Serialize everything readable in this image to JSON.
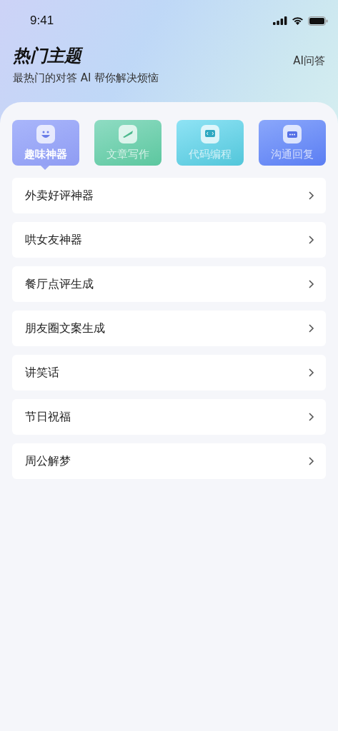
{
  "status_bar": {
    "time": "9:41"
  },
  "header": {
    "title": "热门主题",
    "subtitle": "最热门的对答 AI 帮你解决烦恼",
    "action": "AI问答"
  },
  "tabs": [
    {
      "label": "趣味神器",
      "selected": true,
      "kind": "fun"
    },
    {
      "label": "文章写作",
      "selected": false,
      "kind": "writing"
    },
    {
      "label": "代码编程",
      "selected": false,
      "kind": "code"
    },
    {
      "label": "沟通回复",
      "selected": false,
      "kind": "chat"
    }
  ],
  "items": [
    {
      "label": "外卖好评神器"
    },
    {
      "label": "哄女友神器"
    },
    {
      "label": "餐厅点评生成"
    },
    {
      "label": "朋友圈文案生成"
    },
    {
      "label": "讲笑话"
    },
    {
      "label": "节日祝福"
    },
    {
      "label": "周公解梦"
    }
  ]
}
